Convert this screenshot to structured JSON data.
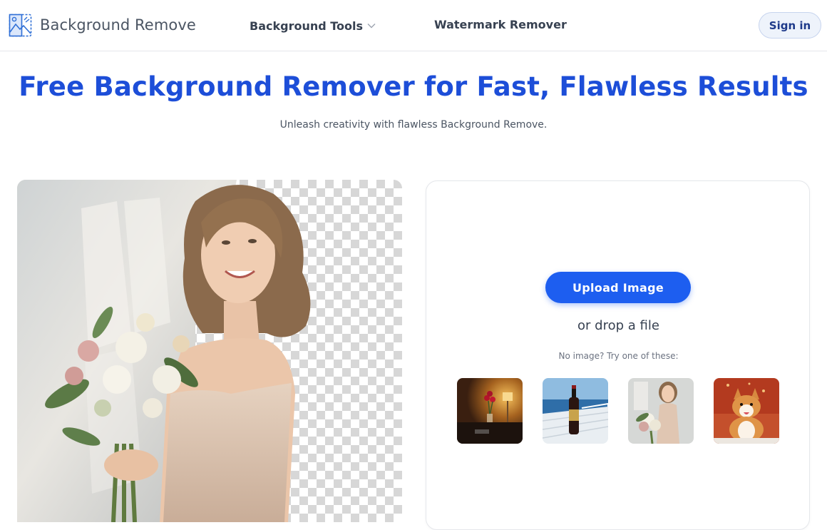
{
  "header": {
    "brand": "Background Remove",
    "nav": {
      "tools_label": "Background Tools",
      "watermark_label": "Watermark Remover"
    },
    "signin_label": "Sign in"
  },
  "hero": {
    "title": "Free Background Remover for Fast, Flawless Results",
    "subtitle": "Unleash creativity with flawless Background Remove."
  },
  "upload": {
    "button_label": "Upload Image",
    "drop_text": "or drop a file",
    "try_text": "No image? Try one of these:"
  },
  "samples": [
    {
      "name": "roses-table"
    },
    {
      "name": "wine-bottle-boat"
    },
    {
      "name": "woman-bouquet"
    },
    {
      "name": "corgi-dog"
    }
  ],
  "colors": {
    "accent": "#1d4ed8",
    "button": "#1d5ef0"
  }
}
